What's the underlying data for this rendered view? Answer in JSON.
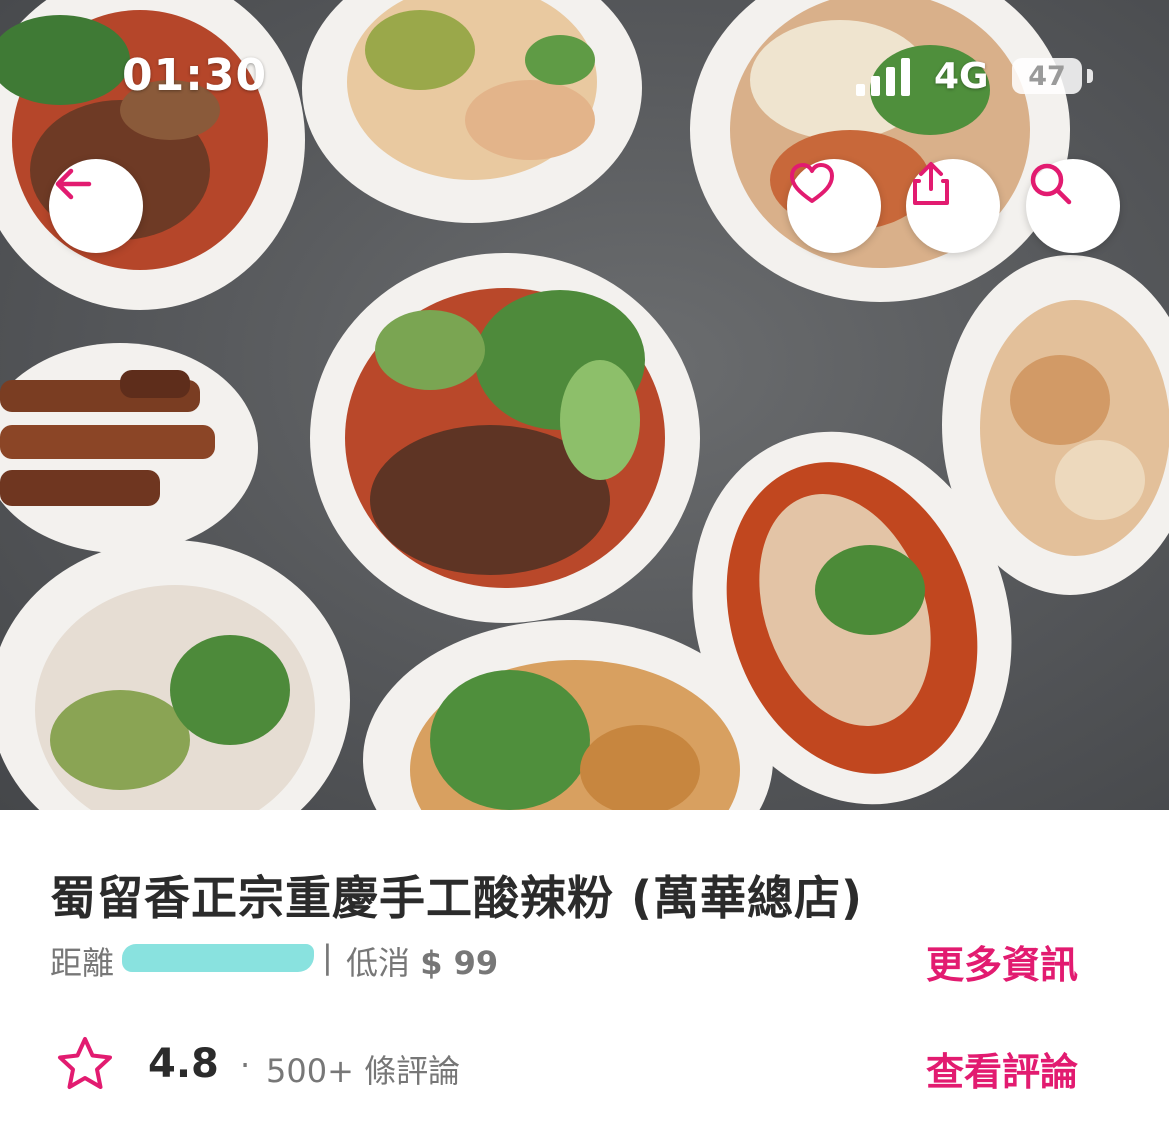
{
  "status_bar": {
    "time": "01:30",
    "network": "4G",
    "battery": "47"
  },
  "header": {
    "back_icon": "arrow-left-icon",
    "favorite_icon": "heart-icon",
    "share_icon": "share-icon",
    "search_icon": "search-icon"
  },
  "hero": {
    "image": "top-down photo of bowls of hot and sour noodles, wontons and spicy chicken"
  },
  "restaurant": {
    "name": "蜀留香正宗重慶手工酸辣粉 (萬華總店)",
    "distance_label": "距離",
    "separator": "|",
    "min_spend_label": "低消",
    "min_spend_value": "$ 99",
    "more_info": "更多資訊",
    "rating": "4.8",
    "dot": "·",
    "reviews_count": "500+ 條評論",
    "view_reviews": "查看評論"
  },
  "colors": {
    "accent": "#e21b70",
    "text_primary": "#2b2b2b",
    "text_secondary": "#777777"
  }
}
